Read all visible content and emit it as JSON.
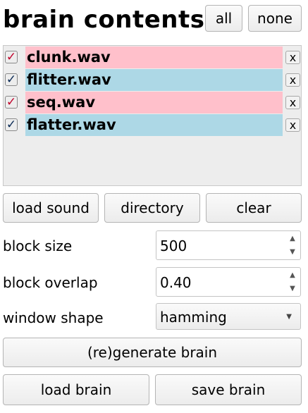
{
  "header": {
    "title": "brain contents",
    "all_label": "all",
    "none_label": "none"
  },
  "sounds": [
    {
      "checked": "✓",
      "name": "clunk.wav",
      "remove": "x",
      "check_color": "#c0002a",
      "row_color": "#ffc0cb"
    },
    {
      "checked": "✓",
      "name": "flitter.wav",
      "remove": "x",
      "check_color": "#0a2a55",
      "row_color": "#add8e6"
    },
    {
      "checked": "✓",
      "name": "seq.wav",
      "remove": "x",
      "check_color": "#c0002a",
      "row_color": "#ffc0cb"
    },
    {
      "checked": "✓",
      "name": "flatter.wav",
      "remove": "x",
      "check_color": "#0a2a55",
      "row_color": "#add8e6"
    }
  ],
  "actions": {
    "load_sound": "load sound",
    "directory": "directory",
    "clear": "clear"
  },
  "settings": {
    "block_size_label": "block size",
    "block_size_value": "500",
    "block_overlap_label": "block overlap",
    "block_overlap_value": "0.40",
    "window_shape_label": "window shape",
    "window_shape_value": "hamming"
  },
  "brain": {
    "regenerate": "(re)generate brain",
    "load": "load brain",
    "save": "save brain"
  },
  "icons": {
    "spin_up": "▲",
    "spin_down": "▼",
    "dropdown": "▼"
  }
}
